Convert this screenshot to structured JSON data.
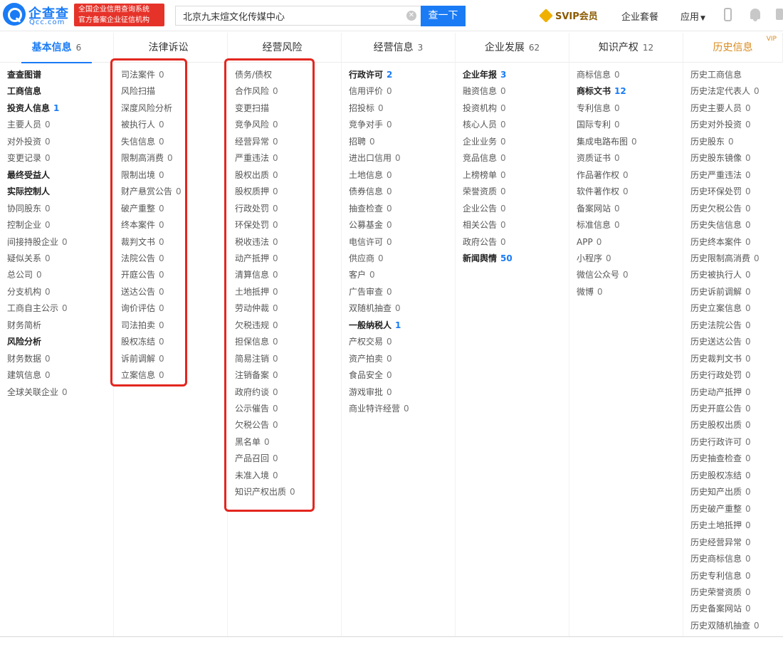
{
  "header": {
    "logo_name": "企查查",
    "logo_domain": "Qcc.com",
    "badge_line1": "全国企业信用查询系统",
    "badge_line2": "官方备案企业征信机构",
    "search_value": "北京九末煊文化传媒中心",
    "search_button": "查一下",
    "svip": "SVIP会员",
    "enterprise_link": "企业套餐",
    "apps_link": "应用",
    "apps_caret": "▼"
  },
  "tabs": [
    {
      "label": "基本信息",
      "count": "6"
    },
    {
      "label": "法律诉讼",
      "count": ""
    },
    {
      "label": "经营风险",
      "count": ""
    },
    {
      "label": "经营信息",
      "count": "3"
    },
    {
      "label": "企业发展",
      "count": "62"
    },
    {
      "label": "知识产权",
      "count": "12"
    },
    {
      "label": "历史信息",
      "count": "",
      "vip": "VIP"
    }
  ],
  "columns": [
    {
      "name": "basic",
      "items": [
        {
          "label": "查查图谱",
          "count": "",
          "style": "bold"
        },
        {
          "label": "工商信息",
          "count": "",
          "style": "bold"
        },
        {
          "label": "投资人信息",
          "count": "1",
          "style": "bold-blue"
        },
        {
          "label": "主要人员",
          "count": "0"
        },
        {
          "label": "对外投资",
          "count": "0"
        },
        {
          "label": "变更记录",
          "count": "0"
        },
        {
          "label": "最终受益人",
          "count": "",
          "style": "bold"
        },
        {
          "label": "实际控制人",
          "count": "",
          "style": "bold"
        },
        {
          "label": "协同股东",
          "count": "0"
        },
        {
          "label": "控制企业",
          "count": "0"
        },
        {
          "label": "间接持股企业",
          "count": "0"
        },
        {
          "label": "疑似关系",
          "count": "0"
        },
        {
          "label": "总公司",
          "count": "0"
        },
        {
          "label": "分支机构",
          "count": "0"
        },
        {
          "label": "工商自主公示",
          "count": "0"
        },
        {
          "label": "财务简析",
          "count": ""
        },
        {
          "label": "风险分析",
          "count": "",
          "style": "bold"
        },
        {
          "label": "财务数据",
          "count": "0"
        },
        {
          "label": "建筑信息",
          "count": "0"
        },
        {
          "label": "全球关联企业",
          "count": "0"
        }
      ]
    },
    {
      "name": "legal",
      "items": [
        {
          "label": "司法案件",
          "count": "0"
        },
        {
          "label": "风险扫描",
          "count": ""
        },
        {
          "label": "深度风险分析",
          "count": ""
        },
        {
          "label": "被执行人",
          "count": "0"
        },
        {
          "label": "失信信息",
          "count": "0"
        },
        {
          "label": "限制高消费",
          "count": "0"
        },
        {
          "label": "限制出境",
          "count": "0"
        },
        {
          "label": "财产悬赏公告",
          "count": "0"
        },
        {
          "label": "破产重整",
          "count": "0"
        },
        {
          "label": "终本案件",
          "count": "0"
        },
        {
          "label": "裁判文书",
          "count": "0"
        },
        {
          "label": "法院公告",
          "count": "0"
        },
        {
          "label": "开庭公告",
          "count": "0"
        },
        {
          "label": "送达公告",
          "count": "0"
        },
        {
          "label": "询价评估",
          "count": "0"
        },
        {
          "label": "司法拍卖",
          "count": "0"
        },
        {
          "label": "股权冻结",
          "count": "0"
        },
        {
          "label": "诉前调解",
          "count": "0"
        },
        {
          "label": "立案信息",
          "count": "0"
        }
      ]
    },
    {
      "name": "risk",
      "items": [
        {
          "label": "债务/债权",
          "count": ""
        },
        {
          "label": "合作风险",
          "count": "0"
        },
        {
          "label": "变更扫描",
          "count": ""
        },
        {
          "label": "竞争风险",
          "count": "0"
        },
        {
          "label": "经营异常",
          "count": "0"
        },
        {
          "label": "严重违法",
          "count": "0"
        },
        {
          "label": "股权出质",
          "count": "0"
        },
        {
          "label": "股权质押",
          "count": "0"
        },
        {
          "label": "行政处罚",
          "count": "0"
        },
        {
          "label": "环保处罚",
          "count": "0"
        },
        {
          "label": "税收违法",
          "count": "0"
        },
        {
          "label": "动产抵押",
          "count": "0"
        },
        {
          "label": "清算信息",
          "count": "0"
        },
        {
          "label": "土地抵押",
          "count": "0"
        },
        {
          "label": "劳动仲裁",
          "count": "0"
        },
        {
          "label": "欠税违规",
          "count": "0"
        },
        {
          "label": "担保信息",
          "count": "0"
        },
        {
          "label": "简易注销",
          "count": "0"
        },
        {
          "label": "注销备案",
          "count": "0"
        },
        {
          "label": "政府约谈",
          "count": "0"
        },
        {
          "label": "公示催告",
          "count": "0"
        },
        {
          "label": "欠税公告",
          "count": "0"
        },
        {
          "label": "黑名单",
          "count": "0"
        },
        {
          "label": "产品召回",
          "count": "0"
        },
        {
          "label": "未准入境",
          "count": "0"
        },
        {
          "label": "知识产权出质",
          "count": "0"
        }
      ]
    },
    {
      "name": "operation",
      "items": [
        {
          "label": "行政许可",
          "count": "2",
          "style": "bold-blue"
        },
        {
          "label": "信用评价",
          "count": "0"
        },
        {
          "label": "招投标",
          "count": "0"
        },
        {
          "label": "竞争对手",
          "count": "0"
        },
        {
          "label": "招聘",
          "count": "0"
        },
        {
          "label": "进出口信用",
          "count": "0"
        },
        {
          "label": "土地信息",
          "count": "0"
        },
        {
          "label": "债券信息",
          "count": "0"
        },
        {
          "label": "抽查检查",
          "count": "0"
        },
        {
          "label": "公募基金",
          "count": "0"
        },
        {
          "label": "电信许可",
          "count": "0"
        },
        {
          "label": "供应商",
          "count": "0"
        },
        {
          "label": "客户",
          "count": "0"
        },
        {
          "label": "广告审查",
          "count": "0"
        },
        {
          "label": "双随机抽查",
          "count": "0"
        },
        {
          "label": "一般纳税人",
          "count": "1",
          "style": "bold-blue"
        },
        {
          "label": "产权交易",
          "count": "0"
        },
        {
          "label": "资产拍卖",
          "count": "0"
        },
        {
          "label": "食品安全",
          "count": "0"
        },
        {
          "label": "游戏审批",
          "count": "0"
        },
        {
          "label": "商业特许经营",
          "count": "0"
        }
      ]
    },
    {
      "name": "development",
      "items": [
        {
          "label": "企业年报",
          "count": "3",
          "style": "bold-blue"
        },
        {
          "label": "融资信息",
          "count": "0"
        },
        {
          "label": "投资机构",
          "count": "0"
        },
        {
          "label": "核心人员",
          "count": "0"
        },
        {
          "label": "企业业务",
          "count": "0"
        },
        {
          "label": "竞品信息",
          "count": "0"
        },
        {
          "label": "上榜榜单",
          "count": "0"
        },
        {
          "label": "荣誉资质",
          "count": "0"
        },
        {
          "label": "企业公告",
          "count": "0"
        },
        {
          "label": "相关公告",
          "count": "0"
        },
        {
          "label": "政府公告",
          "count": "0"
        },
        {
          "label": "新闻舆情",
          "count": "50",
          "style": "bold-blue"
        }
      ]
    },
    {
      "name": "ip",
      "items": [
        {
          "label": "商标信息",
          "count": "0"
        },
        {
          "label": "商标文书",
          "count": "12",
          "style": "bold-blue"
        },
        {
          "label": "专利信息",
          "count": "0"
        },
        {
          "label": "国际专利",
          "count": "0"
        },
        {
          "label": "集成电路布图",
          "count": "0"
        },
        {
          "label": "资质证书",
          "count": "0"
        },
        {
          "label": "作品著作权",
          "count": "0"
        },
        {
          "label": "软件著作权",
          "count": "0"
        },
        {
          "label": "备案网站",
          "count": "0"
        },
        {
          "label": "标准信息",
          "count": "0"
        },
        {
          "label": "APP",
          "count": "0"
        },
        {
          "label": "小程序",
          "count": "0"
        },
        {
          "label": "微信公众号",
          "count": "0"
        },
        {
          "label": "微博",
          "count": "0"
        }
      ]
    },
    {
      "name": "history",
      "items": [
        {
          "label": "历史工商信息",
          "count": ""
        },
        {
          "label": "历史法定代表人",
          "count": "0"
        },
        {
          "label": "历史主要人员",
          "count": "0"
        },
        {
          "label": "历史对外投资",
          "count": "0"
        },
        {
          "label": "历史股东",
          "count": "0"
        },
        {
          "label": "历史股东镜像",
          "count": "0"
        },
        {
          "label": "历史严重违法",
          "count": "0"
        },
        {
          "label": "历史环保处罚",
          "count": "0"
        },
        {
          "label": "历史欠税公告",
          "count": "0"
        },
        {
          "label": "历史失信信息",
          "count": "0"
        },
        {
          "label": "历史终本案件",
          "count": "0"
        },
        {
          "label": "历史限制高消费",
          "count": "0"
        },
        {
          "label": "历史被执行人",
          "count": "0"
        },
        {
          "label": "历史诉前调解",
          "count": "0"
        },
        {
          "label": "历史立案信息",
          "count": "0"
        },
        {
          "label": "历史法院公告",
          "count": "0"
        },
        {
          "label": "历史送达公告",
          "count": "0"
        },
        {
          "label": "历史裁判文书",
          "count": "0"
        },
        {
          "label": "历史行政处罚",
          "count": "0"
        },
        {
          "label": "历史动产抵押",
          "count": "0"
        },
        {
          "label": "历史开庭公告",
          "count": "0"
        },
        {
          "label": "历史股权出质",
          "count": "0"
        },
        {
          "label": "历史行政许可",
          "count": "0"
        },
        {
          "label": "历史抽查检查",
          "count": "0"
        },
        {
          "label": "历史股权冻结",
          "count": "0"
        },
        {
          "label": "历史知产出质",
          "count": "0"
        },
        {
          "label": "历史破产重整",
          "count": "0"
        },
        {
          "label": "历史土地抵押",
          "count": "0"
        },
        {
          "label": "历史经营异常",
          "count": "0"
        },
        {
          "label": "历史商标信息",
          "count": "0"
        },
        {
          "label": "历史专利信息",
          "count": "0"
        },
        {
          "label": "历史荣誉资质",
          "count": "0"
        },
        {
          "label": "历史备案网站",
          "count": "0"
        },
        {
          "label": "历史双随机抽查",
          "count": "0"
        }
      ]
    }
  ],
  "colors": {
    "brand_blue": "#1a7bf5",
    "badge_red": "#e6332a",
    "annotation_red": "#e3261f",
    "history_orange": "#d98a1e"
  }
}
